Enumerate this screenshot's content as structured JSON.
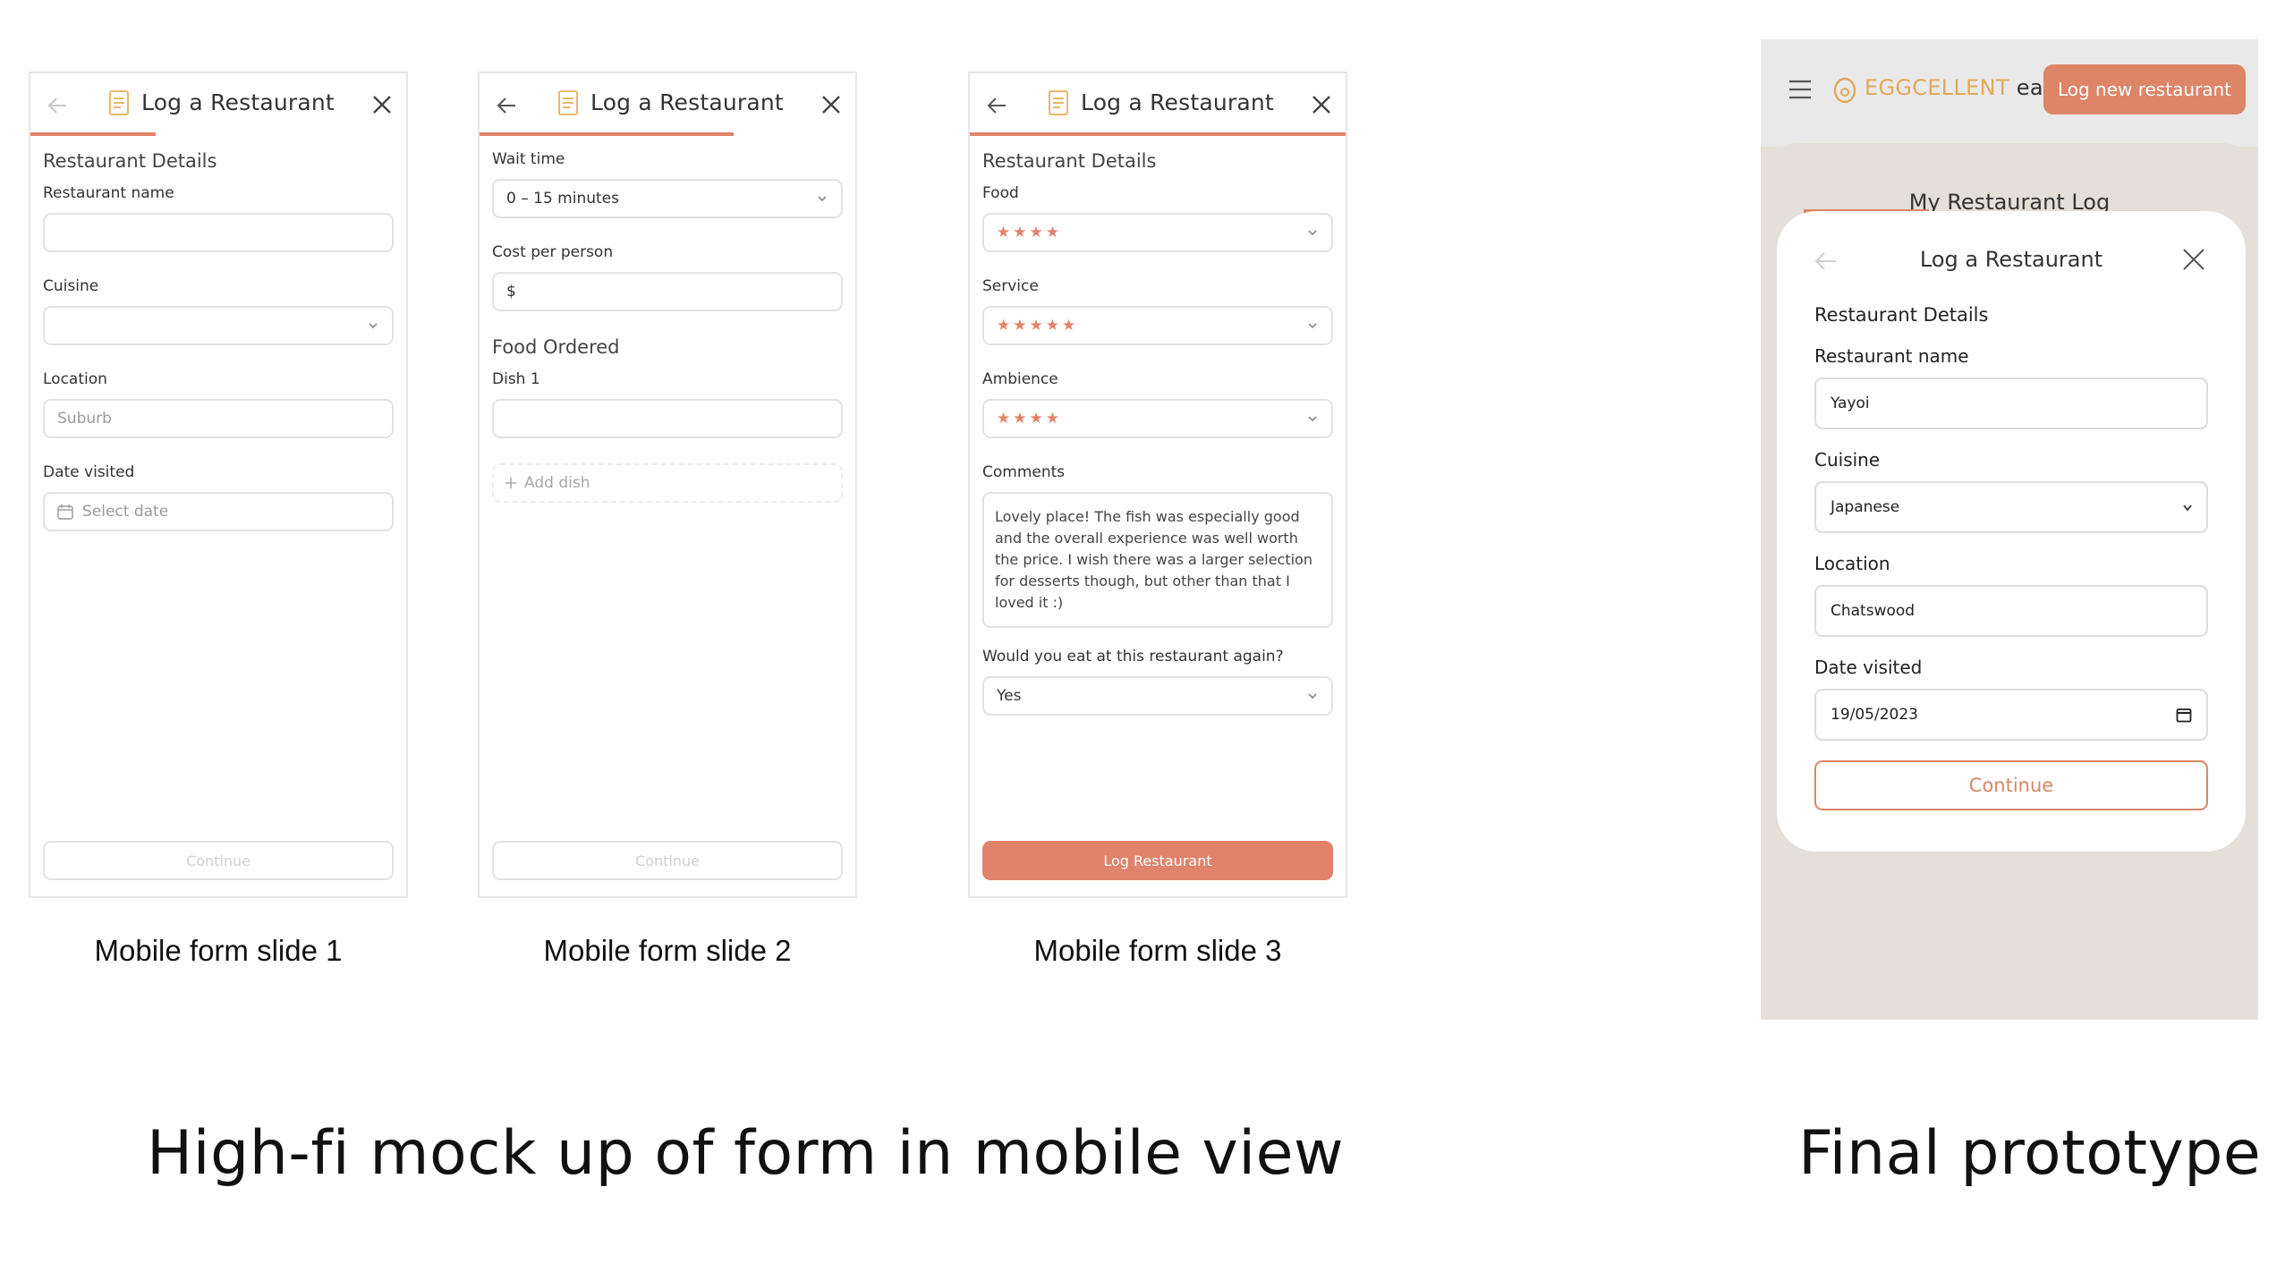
{
  "mockups": {
    "slide1": {
      "header_title": "Log a Restaurant",
      "section_title": "Restaurant Details",
      "restaurant_name_label": "Restaurant name",
      "cuisine_label": "Cuisine",
      "location_label": "Location",
      "location_placeholder": "Suburb",
      "date_label": "Date visited",
      "date_placeholder": "Select date",
      "button": "Continue",
      "caption": "Mobile form slide 1"
    },
    "slide2": {
      "header_title": "Log a Restaurant",
      "wait_label": "Wait time",
      "wait_value": "0 – 15 minutes",
      "cost_label": "Cost per person",
      "cost_value": "$",
      "food_section": "Food Ordered",
      "dish_label": "Dish 1",
      "add_dish": "Add dish",
      "button": "Continue",
      "caption": "Mobile form slide 2"
    },
    "slide3": {
      "header_title": "Log a Restaurant",
      "section_title": "Restaurant Details",
      "food_label": "Food",
      "food_stars": "★★★★",
      "service_label": "Service",
      "service_stars": "★★★★★",
      "ambience_label": "Ambience",
      "ambience_stars": "★★★★",
      "comments_label": "Comments",
      "comments_text": "Lovely place! The fish was especially good and the overall experience was well worth the price. I wish there was a larger selection for desserts though, but other than that I loved it :)",
      "again_label": "Would you eat at this restaurant again?",
      "again_value": "Yes",
      "button": "Log Restaurant",
      "caption": "Mobile form slide 3"
    }
  },
  "captions": {
    "mockup_section": "High-fi mock up of form in mobile view",
    "prototype_section": "Final prototype"
  },
  "prototype": {
    "brand_name": "EGGCELLENT",
    "brand_suffix": "eats",
    "log_new_button": "Log new restaurant",
    "page_title": "My Restaurant Log",
    "modal_title": "Log a Restaurant",
    "section_title": "Restaurant Details",
    "restaurant_name_label": "Restaurant name",
    "restaurant_name_value": "Yayoi",
    "cuisine_label": "Cuisine",
    "cuisine_value": "Japanese",
    "location_label": "Location",
    "location_value": "Chatswood",
    "date_label": "Date visited",
    "date_value": "19/05/2023",
    "continue_button": "Continue"
  },
  "colors": {
    "accent": "#e0836a",
    "brand_yellow": "#e1a95b",
    "prototype_bg": "#e4dfd8"
  },
  "icons": [
    "back-arrow-icon",
    "document-icon",
    "close-icon",
    "chevron-down-icon",
    "calendar-icon",
    "plus-icon",
    "hamburger-icon",
    "egg-logo-icon"
  ]
}
